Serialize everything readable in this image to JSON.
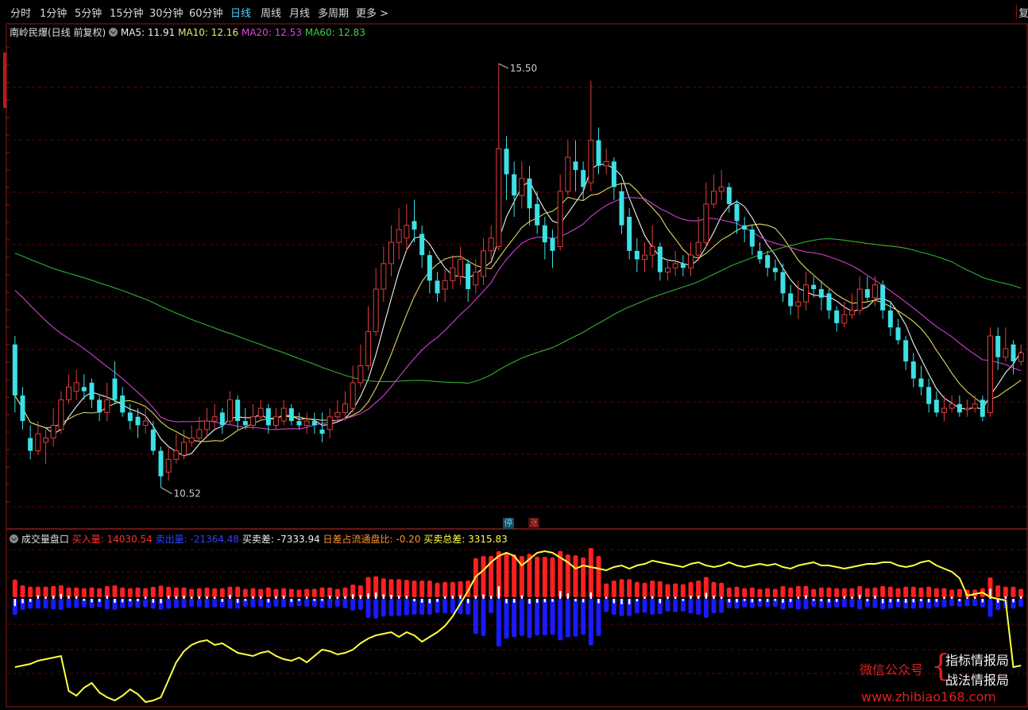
{
  "toolbar": {
    "items": [
      "分时",
      "1分钟",
      "5分钟",
      "15分钟",
      "30分钟",
      "60分钟",
      "日线",
      "周线",
      "月线",
      "多周期",
      "更多 >"
    ],
    "active": "日线",
    "right_button": "复"
  },
  "main_header": {
    "stock": "南岭民爆(日线 前复权)",
    "ma5": "MA5: 11.91",
    "ma10": "MA10: 12.16",
    "ma20": "MA20: 12.53",
    "ma60": "MA60: 12.83"
  },
  "colors": {
    "up": "#e03c3c",
    "down": "#3ce0e6",
    "ma5": "#f0f0f0",
    "ma10": "#d8d860",
    "ma20": "#d040d0",
    "ma60": "#30b030",
    "buy_bar": "#ff2020",
    "sell_bar": "#1a1aff",
    "diff_line": "#ffff40",
    "grid": "#6a0000",
    "frame": "#8a1c1c"
  },
  "markers": {
    "high": "15.50",
    "low": "10.52",
    "tag_stop": "停",
    "tag_up": "涨"
  },
  "sub_header": {
    "title": "成交量盘口",
    "buy": "买入量: 14030.54",
    "sell": "卖出量: -21364.48",
    "diff": "买卖差: -7333.94",
    "ratio": "日差占流通盘比: -0.20",
    "total": "买卖总差: 3315.83"
  },
  "watermark": {
    "wechat": "微信公众号",
    "line1": "指标情报局",
    "line2": "战法情报局",
    "site": "www.zhibiao168.com"
  },
  "chart_data": {
    "type": "candlestick",
    "series": [
      {
        "name": "MA5",
        "value": 11.91
      },
      {
        "name": "MA10",
        "value": 12.16
      },
      {
        "name": "MA20",
        "value": 12.53
      },
      {
        "name": "MA60",
        "value": 12.83
      }
    ],
    "price_range": [
      10.2,
      15.8
    ],
    "high": 15.5,
    "low": 10.52,
    "candles": [
      [
        12.2,
        11.6,
        12.3,
        11.4
      ],
      [
        11.6,
        11.3,
        11.7,
        11.2
      ],
      [
        11.1,
        10.95,
        11.25,
        10.85
      ],
      [
        10.95,
        11.15,
        11.3,
        10.9
      ],
      [
        11.05,
        11.1,
        11.2,
        10.8
      ],
      [
        11.1,
        11.25,
        11.45,
        11.0
      ],
      [
        11.2,
        11.55,
        11.65,
        11.15
      ],
      [
        11.55,
        11.7,
        11.85,
        11.5
      ],
      [
        11.65,
        11.75,
        11.9,
        11.55
      ],
      [
        11.7,
        11.65,
        11.85,
        11.55
      ],
      [
        11.75,
        11.55,
        11.8,
        11.45
      ],
      [
        11.55,
        11.4,
        11.6,
        11.3
      ],
      [
        11.4,
        11.55,
        11.75,
        11.3
      ],
      [
        11.8,
        11.55,
        12.0,
        11.5
      ],
      [
        11.6,
        11.4,
        11.7,
        11.35
      ],
      [
        11.4,
        11.3,
        11.5,
        11.2
      ],
      [
        11.35,
        11.25,
        11.45,
        11.1
      ],
      [
        11.25,
        11.3,
        11.45,
        11.15
      ],
      [
        11.2,
        10.95,
        11.3,
        10.9
      ],
      [
        10.95,
        10.65,
        11.0,
        10.52
      ],
      [
        10.7,
        10.85,
        11.0,
        10.6
      ],
      [
        10.85,
        10.95,
        11.15,
        10.8
      ],
      [
        10.9,
        11.05,
        11.2,
        10.85
      ],
      [
        11.05,
        11.1,
        11.25,
        11.0
      ],
      [
        11.1,
        11.2,
        11.35,
        11.05
      ],
      [
        11.2,
        11.3,
        11.45,
        11.1
      ],
      [
        11.3,
        11.35,
        11.5,
        11.2
      ],
      [
        11.4,
        11.25,
        11.45,
        11.15
      ],
      [
        11.3,
        11.55,
        11.65,
        11.25
      ],
      [
        11.55,
        11.3,
        11.6,
        11.2
      ],
      [
        11.3,
        11.25,
        11.45,
        11.2
      ],
      [
        11.25,
        11.35,
        11.5,
        11.2
      ],
      [
        11.35,
        11.45,
        11.55,
        11.3
      ],
      [
        11.45,
        11.25,
        11.5,
        11.15
      ],
      [
        11.25,
        11.35,
        11.45,
        11.2
      ],
      [
        11.3,
        11.45,
        11.55,
        11.25
      ],
      [
        11.45,
        11.3,
        11.5,
        11.25
      ],
      [
        11.3,
        11.25,
        11.4,
        11.2
      ],
      [
        11.25,
        11.3,
        11.4,
        11.15
      ],
      [
        11.3,
        11.25,
        11.4,
        11.15
      ],
      [
        11.2,
        11.15,
        11.4,
        11.05
      ],
      [
        11.2,
        11.35,
        11.45,
        11.1
      ],
      [
        11.35,
        11.4,
        11.55,
        11.3
      ],
      [
        11.4,
        11.5,
        11.65,
        11.3
      ],
      [
        11.45,
        11.75,
        11.95,
        11.4
      ],
      [
        11.75,
        11.95,
        12.2,
        11.7
      ],
      [
        11.95,
        12.35,
        12.65,
        11.9
      ],
      [
        12.35,
        12.85,
        13.1,
        12.3
      ],
      [
        12.85,
        13.15,
        13.35,
        12.7
      ],
      [
        13.15,
        13.4,
        13.6,
        13.0
      ],
      [
        13.4,
        13.55,
        13.8,
        13.2
      ],
      [
        13.45,
        13.6,
        13.85,
        13.3
      ],
      [
        13.65,
        13.55,
        13.9,
        13.4
      ],
      [
        13.5,
        13.25,
        13.6,
        13.1
      ],
      [
        13.25,
        12.95,
        13.3,
        12.8
      ],
      [
        12.95,
        12.8,
        13.05,
        12.7
      ],
      [
        12.85,
        12.95,
        13.1,
        12.7
      ],
      [
        12.95,
        13.1,
        13.25,
        12.85
      ],
      [
        13.0,
        13.2,
        13.35,
        12.9
      ],
      [
        13.15,
        12.85,
        13.2,
        12.7
      ],
      [
        12.9,
        13.05,
        13.2,
        12.8
      ],
      [
        13.0,
        13.3,
        13.45,
        12.9
      ],
      [
        13.3,
        13.45,
        13.6,
        13.2
      ],
      [
        13.35,
        14.5,
        15.5,
        13.3
      ],
      [
        14.5,
        14.2,
        14.65,
        13.9
      ],
      [
        14.2,
        13.95,
        14.35,
        13.7
      ],
      [
        13.95,
        14.15,
        14.35,
        13.8
      ],
      [
        14.15,
        13.8,
        14.3,
        13.6
      ],
      [
        13.85,
        13.6,
        14.0,
        13.5
      ],
      [
        13.6,
        13.4,
        13.7,
        13.2
      ],
      [
        13.45,
        13.3,
        13.55,
        13.1
      ],
      [
        13.35,
        14.0,
        14.2,
        13.3
      ],
      [
        14.0,
        14.4,
        14.6,
        13.95
      ],
      [
        14.35,
        14.25,
        14.6,
        14.0
      ],
      [
        14.25,
        14.05,
        14.35,
        13.9
      ],
      [
        14.1,
        14.6,
        15.3,
        14.0
      ],
      [
        14.6,
        14.3,
        14.75,
        14.2
      ],
      [
        14.3,
        14.35,
        14.5,
        14.2
      ],
      [
        14.35,
        14.05,
        14.4,
        13.9
      ],
      [
        14.0,
        13.6,
        14.1,
        13.5
      ],
      [
        13.7,
        13.3,
        13.8,
        13.2
      ],
      [
        13.3,
        13.2,
        13.45,
        13.05
      ],
      [
        13.2,
        13.25,
        13.4,
        13.05
      ],
      [
        13.25,
        13.35,
        13.6,
        13.1
      ],
      [
        13.35,
        13.05,
        13.4,
        12.95
      ],
      [
        13.05,
        13.1,
        13.2,
        12.95
      ],
      [
        13.1,
        13.15,
        13.3,
        13.0
      ],
      [
        13.15,
        13.1,
        13.25,
        13.0
      ],
      [
        13.1,
        13.25,
        13.4,
        13.0
      ],
      [
        13.25,
        13.4,
        13.7,
        13.2
      ],
      [
        13.4,
        13.85,
        14.1,
        13.35
      ],
      [
        13.85,
        14.0,
        14.2,
        13.8
      ],
      [
        14.0,
        14.05,
        14.25,
        13.9
      ],
      [
        14.05,
        13.85,
        14.1,
        13.75
      ],
      [
        13.85,
        13.65,
        13.9,
        13.5
      ],
      [
        13.6,
        13.55,
        13.7,
        13.4
      ],
      [
        13.55,
        13.35,
        13.6,
        13.25
      ],
      [
        13.3,
        13.2,
        13.4,
        13.15
      ],
      [
        13.25,
        13.1,
        13.3,
        13.0
      ],
      [
        13.1,
        13.05,
        13.2,
        12.95
      ],
      [
        13.05,
        12.8,
        13.15,
        12.7
      ],
      [
        12.8,
        12.65,
        12.9,
        12.55
      ],
      [
        12.65,
        12.7,
        12.95,
        12.5
      ],
      [
        12.7,
        12.9,
        13.05,
        12.6
      ],
      [
        12.9,
        12.85,
        13.0,
        12.75
      ],
      [
        12.85,
        12.75,
        12.95,
        12.6
      ],
      [
        12.8,
        12.6,
        12.85,
        12.5
      ],
      [
        12.6,
        12.45,
        12.65,
        12.35
      ],
      [
        12.45,
        12.55,
        12.7,
        12.4
      ],
      [
        12.55,
        12.6,
        12.8,
        12.5
      ],
      [
        12.6,
        12.85,
        13.0,
        12.55
      ],
      [
        12.85,
        12.75,
        13.0,
        12.7
      ],
      [
        12.75,
        12.9,
        13.0,
        12.65
      ],
      [
        12.9,
        12.6,
        12.95,
        12.5
      ],
      [
        12.6,
        12.4,
        12.7,
        12.3
      ],
      [
        12.4,
        12.25,
        12.5,
        12.2
      ],
      [
        12.25,
        12.0,
        12.3,
        11.9
      ],
      [
        12.0,
        11.8,
        12.1,
        11.7
      ],
      [
        11.8,
        11.7,
        11.95,
        11.6
      ],
      [
        11.7,
        11.5,
        11.8,
        11.4
      ],
      [
        11.55,
        11.4,
        11.65,
        11.35
      ],
      [
        11.4,
        11.45,
        11.6,
        11.3
      ],
      [
        11.45,
        11.5,
        11.6,
        11.4
      ],
      [
        11.5,
        11.4,
        11.6,
        11.35
      ],
      [
        11.45,
        11.45,
        11.55,
        11.35
      ],
      [
        11.45,
        11.5,
        11.6,
        11.4
      ],
      [
        11.55,
        11.35,
        11.6,
        11.3
      ],
      [
        11.4,
        12.3,
        12.4,
        11.35
      ],
      [
        12.3,
        12.05,
        12.4,
        11.9
      ],
      [
        12.05,
        12.15,
        12.4,
        12.0
      ],
      [
        12.2,
        12.0,
        12.25,
        11.85
      ],
      [
        12.0,
        12.1,
        12.2,
        11.95
      ]
    ],
    "indicator": {
      "buy": 14030.54,
      "sell": -21364.48,
      "diff": -7333.94,
      "ratio": -0.2,
      "total_diff": 3315.83
    }
  }
}
